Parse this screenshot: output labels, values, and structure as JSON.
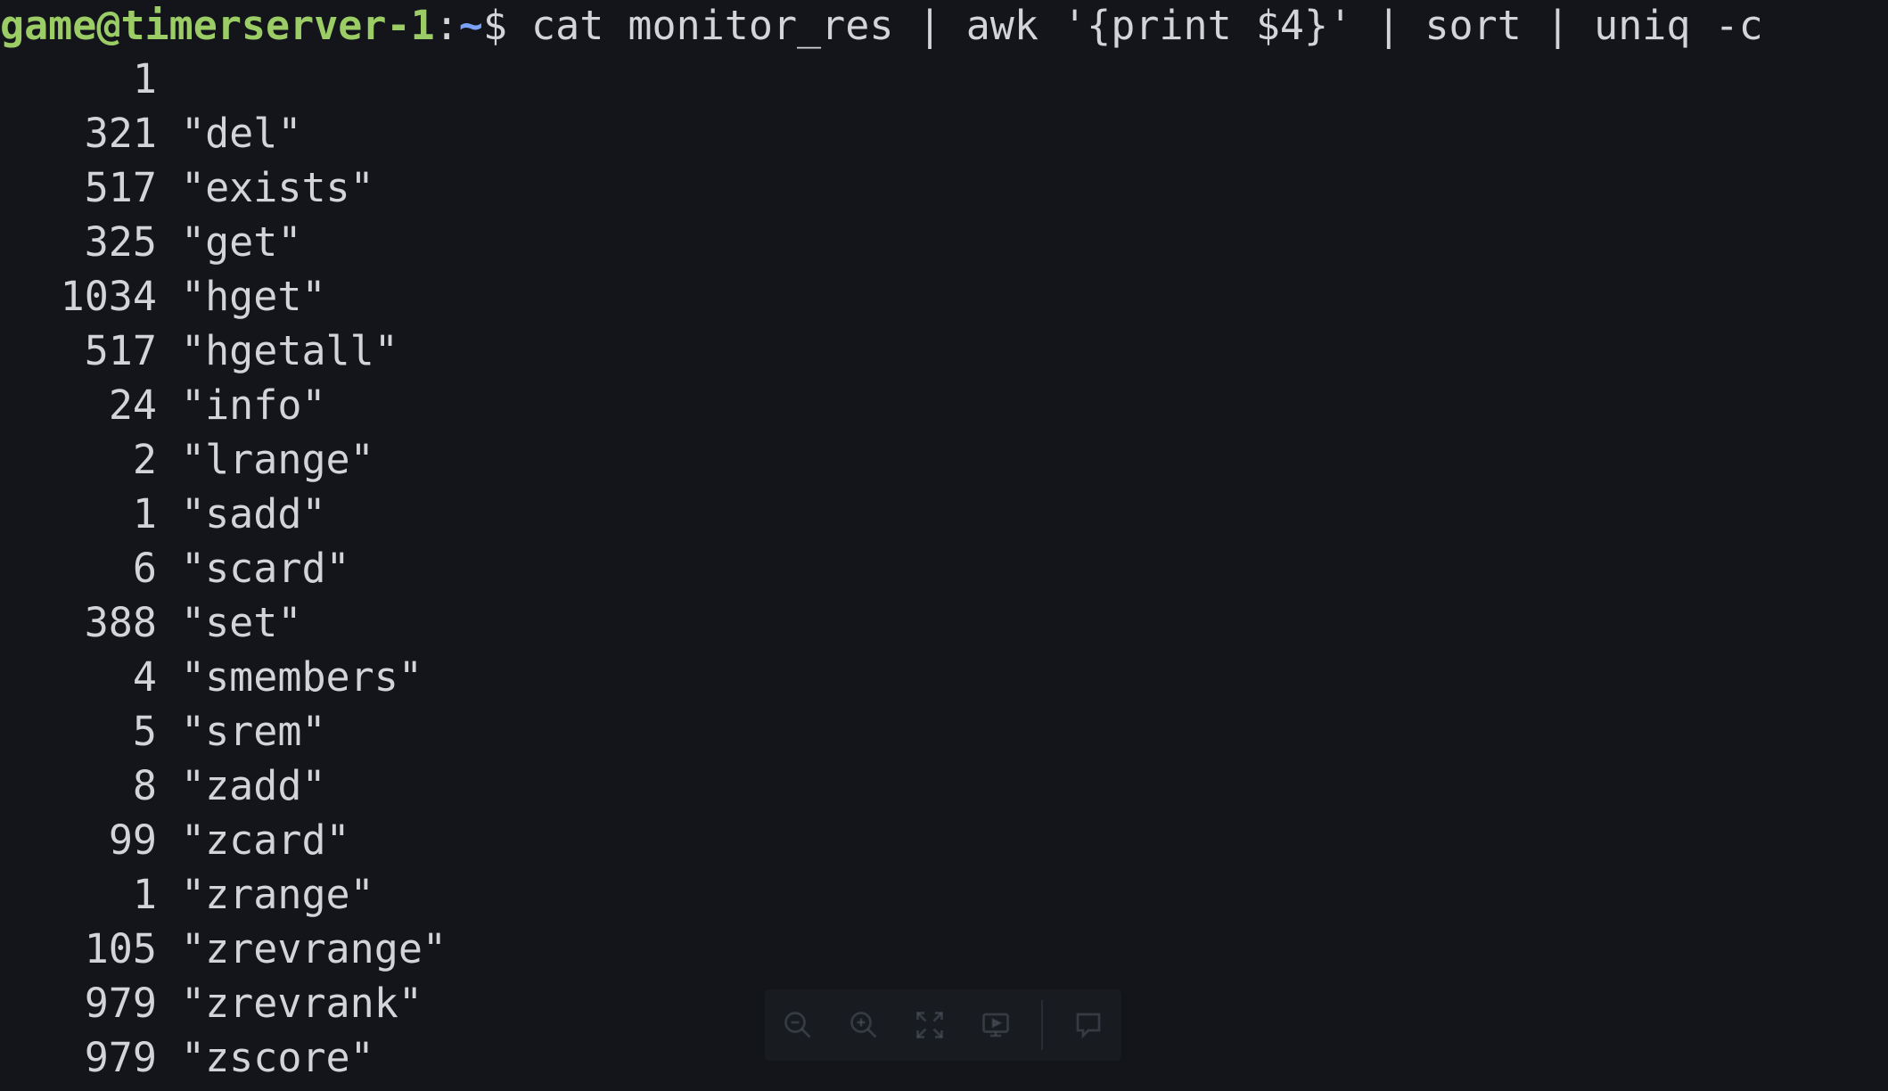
{
  "prompt": {
    "user_host": "game@timerserver-1",
    "colon": ":",
    "path": "~",
    "symbol": "$",
    "command": "cat monitor_res | awk '{print $4}' | sort | uniq -c"
  },
  "output_rows": [
    {
      "count": "1",
      "value": ""
    },
    {
      "count": "321",
      "value": "\"del\""
    },
    {
      "count": "517",
      "value": "\"exists\""
    },
    {
      "count": "325",
      "value": "\"get\""
    },
    {
      "count": "1034",
      "value": "\"hget\""
    },
    {
      "count": "517",
      "value": "\"hgetall\""
    },
    {
      "count": "24",
      "value": "\"info\""
    },
    {
      "count": "2",
      "value": "\"lrange\""
    },
    {
      "count": "1",
      "value": "\"sadd\""
    },
    {
      "count": "6",
      "value": "\"scard\""
    },
    {
      "count": "388",
      "value": "\"set\""
    },
    {
      "count": "4",
      "value": "\"smembers\""
    },
    {
      "count": "5",
      "value": "\"srem\""
    },
    {
      "count": "8",
      "value": "\"zadd\""
    },
    {
      "count": "99",
      "value": "\"zcard\""
    },
    {
      "count": "1",
      "value": "\"zrange\""
    },
    {
      "count": "105",
      "value": "\"zrevrange\""
    },
    {
      "count": "979",
      "value": "\"zrevrank\""
    },
    {
      "count": "979",
      "value": "\"zscore\""
    }
  ],
  "toolbar": {
    "icons": [
      "zoom-out-icon",
      "zoom-in-icon",
      "fullscreen-icon",
      "slideshow-icon",
      "comment-icon"
    ]
  },
  "colors": {
    "background": "#13151a",
    "text": "#d3d4d8",
    "prompt_user": "#9ccc65",
    "prompt_path": "#7aa2f7"
  }
}
